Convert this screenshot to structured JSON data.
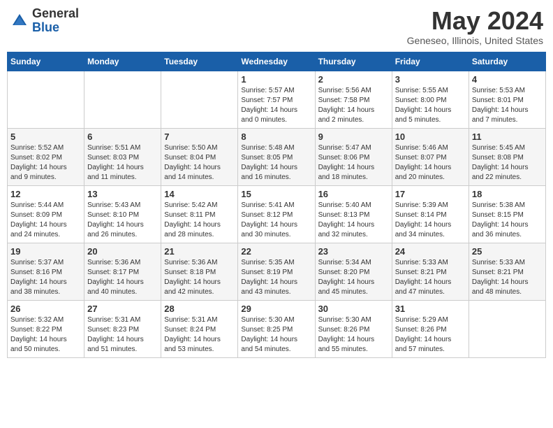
{
  "header": {
    "logo_general": "General",
    "logo_blue": "Blue",
    "month_title": "May 2024",
    "location": "Geneseo, Illinois, United States"
  },
  "weekdays": [
    "Sunday",
    "Monday",
    "Tuesday",
    "Wednesday",
    "Thursday",
    "Friday",
    "Saturday"
  ],
  "weeks": [
    [
      {
        "day": "",
        "info": ""
      },
      {
        "day": "",
        "info": ""
      },
      {
        "day": "",
        "info": ""
      },
      {
        "day": "1",
        "info": "Sunrise: 5:57 AM\nSunset: 7:57 PM\nDaylight: 14 hours\nand 0 minutes."
      },
      {
        "day": "2",
        "info": "Sunrise: 5:56 AM\nSunset: 7:58 PM\nDaylight: 14 hours\nand 2 minutes."
      },
      {
        "day": "3",
        "info": "Sunrise: 5:55 AM\nSunset: 8:00 PM\nDaylight: 14 hours\nand 5 minutes."
      },
      {
        "day": "4",
        "info": "Sunrise: 5:53 AM\nSunset: 8:01 PM\nDaylight: 14 hours\nand 7 minutes."
      }
    ],
    [
      {
        "day": "5",
        "info": "Sunrise: 5:52 AM\nSunset: 8:02 PM\nDaylight: 14 hours\nand 9 minutes."
      },
      {
        "day": "6",
        "info": "Sunrise: 5:51 AM\nSunset: 8:03 PM\nDaylight: 14 hours\nand 11 minutes."
      },
      {
        "day": "7",
        "info": "Sunrise: 5:50 AM\nSunset: 8:04 PM\nDaylight: 14 hours\nand 14 minutes."
      },
      {
        "day": "8",
        "info": "Sunrise: 5:48 AM\nSunset: 8:05 PM\nDaylight: 14 hours\nand 16 minutes."
      },
      {
        "day": "9",
        "info": "Sunrise: 5:47 AM\nSunset: 8:06 PM\nDaylight: 14 hours\nand 18 minutes."
      },
      {
        "day": "10",
        "info": "Sunrise: 5:46 AM\nSunset: 8:07 PM\nDaylight: 14 hours\nand 20 minutes."
      },
      {
        "day": "11",
        "info": "Sunrise: 5:45 AM\nSunset: 8:08 PM\nDaylight: 14 hours\nand 22 minutes."
      }
    ],
    [
      {
        "day": "12",
        "info": "Sunrise: 5:44 AM\nSunset: 8:09 PM\nDaylight: 14 hours\nand 24 minutes."
      },
      {
        "day": "13",
        "info": "Sunrise: 5:43 AM\nSunset: 8:10 PM\nDaylight: 14 hours\nand 26 minutes."
      },
      {
        "day": "14",
        "info": "Sunrise: 5:42 AM\nSunset: 8:11 PM\nDaylight: 14 hours\nand 28 minutes."
      },
      {
        "day": "15",
        "info": "Sunrise: 5:41 AM\nSunset: 8:12 PM\nDaylight: 14 hours\nand 30 minutes."
      },
      {
        "day": "16",
        "info": "Sunrise: 5:40 AM\nSunset: 8:13 PM\nDaylight: 14 hours\nand 32 minutes."
      },
      {
        "day": "17",
        "info": "Sunrise: 5:39 AM\nSunset: 8:14 PM\nDaylight: 14 hours\nand 34 minutes."
      },
      {
        "day": "18",
        "info": "Sunrise: 5:38 AM\nSunset: 8:15 PM\nDaylight: 14 hours\nand 36 minutes."
      }
    ],
    [
      {
        "day": "19",
        "info": "Sunrise: 5:37 AM\nSunset: 8:16 PM\nDaylight: 14 hours\nand 38 minutes."
      },
      {
        "day": "20",
        "info": "Sunrise: 5:36 AM\nSunset: 8:17 PM\nDaylight: 14 hours\nand 40 minutes."
      },
      {
        "day": "21",
        "info": "Sunrise: 5:36 AM\nSunset: 8:18 PM\nDaylight: 14 hours\nand 42 minutes."
      },
      {
        "day": "22",
        "info": "Sunrise: 5:35 AM\nSunset: 8:19 PM\nDaylight: 14 hours\nand 43 minutes."
      },
      {
        "day": "23",
        "info": "Sunrise: 5:34 AM\nSunset: 8:20 PM\nDaylight: 14 hours\nand 45 minutes."
      },
      {
        "day": "24",
        "info": "Sunrise: 5:33 AM\nSunset: 8:21 PM\nDaylight: 14 hours\nand 47 minutes."
      },
      {
        "day": "25",
        "info": "Sunrise: 5:33 AM\nSunset: 8:21 PM\nDaylight: 14 hours\nand 48 minutes."
      }
    ],
    [
      {
        "day": "26",
        "info": "Sunrise: 5:32 AM\nSunset: 8:22 PM\nDaylight: 14 hours\nand 50 minutes."
      },
      {
        "day": "27",
        "info": "Sunrise: 5:31 AM\nSunset: 8:23 PM\nDaylight: 14 hours\nand 51 minutes."
      },
      {
        "day": "28",
        "info": "Sunrise: 5:31 AM\nSunset: 8:24 PM\nDaylight: 14 hours\nand 53 minutes."
      },
      {
        "day": "29",
        "info": "Sunrise: 5:30 AM\nSunset: 8:25 PM\nDaylight: 14 hours\nand 54 minutes."
      },
      {
        "day": "30",
        "info": "Sunrise: 5:30 AM\nSunset: 8:26 PM\nDaylight: 14 hours\nand 55 minutes."
      },
      {
        "day": "31",
        "info": "Sunrise: 5:29 AM\nSunset: 8:26 PM\nDaylight: 14 hours\nand 57 minutes."
      },
      {
        "day": "",
        "info": ""
      }
    ]
  ]
}
